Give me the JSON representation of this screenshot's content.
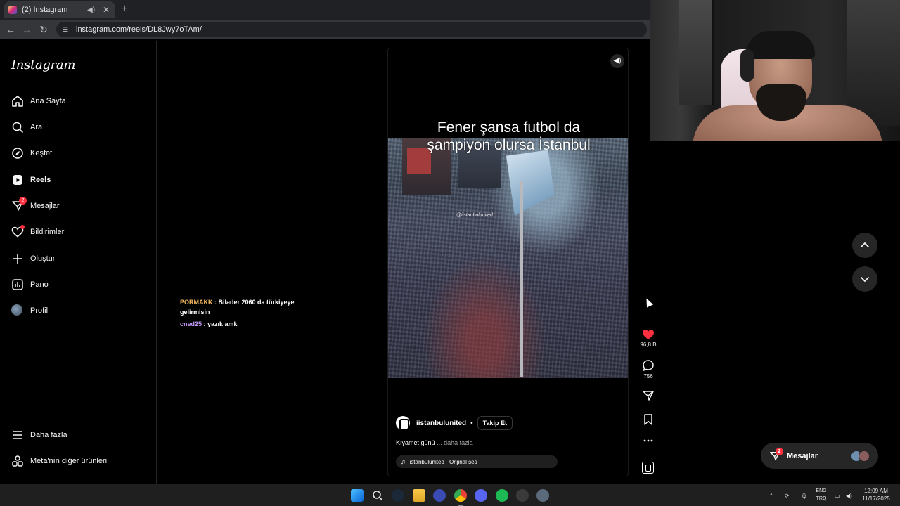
{
  "browser": {
    "tab_title": "(2) Instagram",
    "url": "instagram.com/reels/DL8Jwy7oTAm/",
    "new_tab_label": "+"
  },
  "sidebar": {
    "logo": "Instagram",
    "items": [
      {
        "label": "Ana Sayfa",
        "icon": "home-icon"
      },
      {
        "label": "Ara",
        "icon": "search-icon"
      },
      {
        "label": "Keşfet",
        "icon": "compass-icon"
      },
      {
        "label": "Reels",
        "icon": "reels-icon",
        "active": true
      },
      {
        "label": "Mesajlar",
        "icon": "messenger-icon",
        "badge": "2"
      },
      {
        "label": "Bildirimler",
        "icon": "heart-icon",
        "dot": true
      },
      {
        "label": "Oluştur",
        "icon": "plus-icon"
      },
      {
        "label": "Pano",
        "icon": "dashboard-icon"
      },
      {
        "label": "Profil",
        "icon": "avatar"
      }
    ],
    "bottom_items": [
      {
        "label": "Daha fazla",
        "icon": "menu-icon"
      },
      {
        "label": "Meta'nın diğer ürünleri",
        "icon": "meta-products-icon"
      }
    ]
  },
  "chat": [
    {
      "user": "PORMAKK",
      "message": "Bilader 2060 da türkiyeye gelirmisin"
    },
    {
      "user": "cned25",
      "message": "yazık amk"
    }
  ],
  "reel": {
    "caption_overlay": [
      "Fener şansa futbol da",
      "şampiyon olursa İstanbul"
    ],
    "watermark": "@iistanbulunited",
    "owner": "iistanbulunited",
    "follow_label": "Takip Et",
    "separator": "•",
    "caption": "Kıyamet günü",
    "caption_more": "... daha fazla",
    "audio": "iistanbulunited · Orijinal ses"
  },
  "actions": {
    "likes": "96,8 B",
    "comments": "756",
    "like_color": "#ff3040"
  },
  "messages_float": {
    "label": "Mesajlar",
    "badge": "2"
  },
  "taskbar": {
    "lang_top": "ENG",
    "lang_bottom": "TRQ",
    "time": "12:09 AM",
    "date": "11/17/2025"
  }
}
